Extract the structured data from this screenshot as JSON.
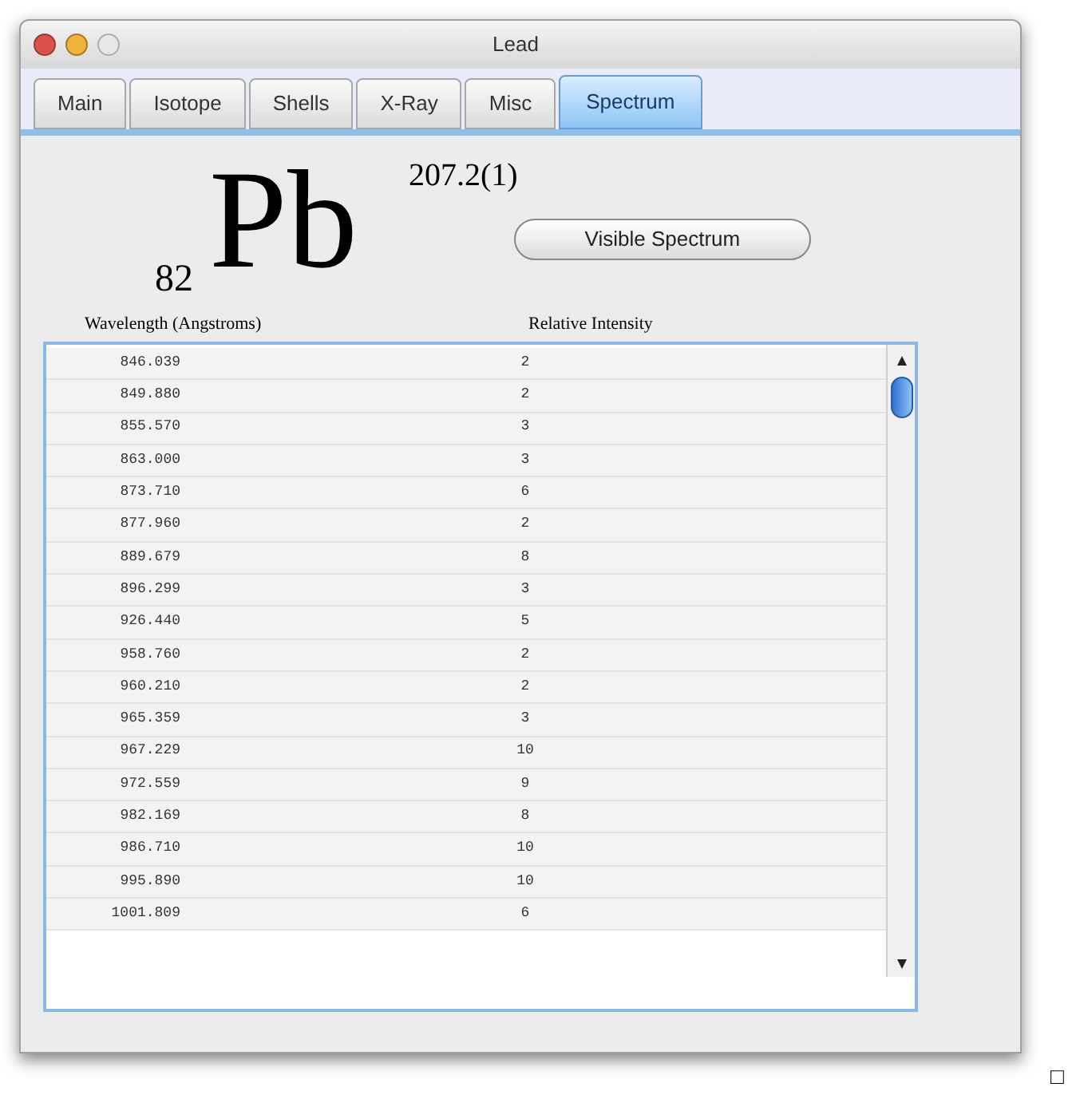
{
  "window": {
    "title": "Lead"
  },
  "tabs": [
    {
      "label": "Main",
      "selected": false
    },
    {
      "label": "Isotope",
      "selected": false
    },
    {
      "label": "Shells",
      "selected": false
    },
    {
      "label": "X-Ray",
      "selected": false
    },
    {
      "label": "Misc",
      "selected": false
    },
    {
      "label": "Spectrum",
      "selected": true
    }
  ],
  "element": {
    "symbol": "Pb",
    "atomic_number": "82",
    "atomic_weight": "207.2(1)"
  },
  "visible_spectrum_button": "Visible Spectrum",
  "table": {
    "columns": [
      "Wavelength (Angstroms)",
      "Relative Intensity"
    ],
    "rows": [
      [
        "846.039",
        "2"
      ],
      [
        "849.880",
        "2"
      ],
      [
        "855.570",
        "3"
      ],
      [
        "863.000",
        "3"
      ],
      [
        "873.710",
        "6"
      ],
      [
        "877.960",
        "2"
      ],
      [
        "889.679",
        "8"
      ],
      [
        "896.299",
        "3"
      ],
      [
        "926.440",
        "5"
      ],
      [
        "958.760",
        "2"
      ],
      [
        "960.210",
        "2"
      ],
      [
        "965.359",
        "3"
      ],
      [
        "967.229",
        "10"
      ],
      [
        "972.559",
        "9"
      ],
      [
        "982.169",
        "8"
      ],
      [
        "986.710",
        "10"
      ],
      [
        "995.890",
        "10"
      ],
      [
        "1001.809",
        "6"
      ]
    ]
  },
  "corner_mark": "□"
}
